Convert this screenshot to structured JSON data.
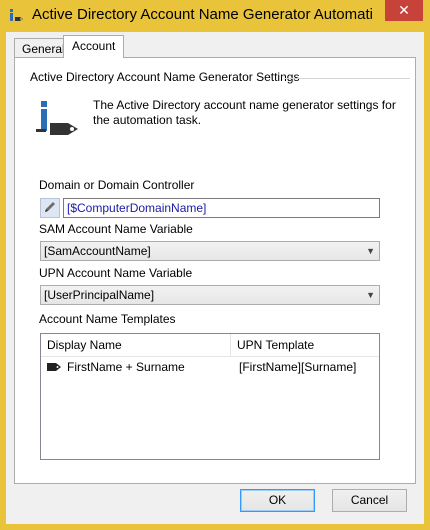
{
  "window": {
    "title": "Active Directory Account Name Generator Automati",
    "close_glyph": "✕"
  },
  "tabs": [
    {
      "label": "General"
    },
    {
      "label": "Account"
    }
  ],
  "group": {
    "title": "Active Directory Account Name Generator Settings"
  },
  "description": "The Active Directory account name generator settings for the automation task.",
  "domain": {
    "label": "Domain or Domain Controller",
    "value": "[$ComputerDomainName]"
  },
  "sam": {
    "label": "SAM Account Name Variable",
    "value": "[SamAccountName]"
  },
  "upn": {
    "label": "UPN Account Name Variable",
    "value": "[UserPrincipalName]"
  },
  "templates": {
    "label": "Account Name Templates",
    "columns": [
      "Display Name",
      "UPN Template"
    ],
    "rows": [
      {
        "display_name": "FirstName + Surname",
        "upn_template": "[FirstName][Surname]"
      }
    ]
  },
  "buttons": {
    "ok": "OK",
    "cancel": "Cancel"
  },
  "colors": {
    "titlebar": "#e9c43a",
    "close": "#c7433a",
    "accent": "#2a6fb5"
  }
}
